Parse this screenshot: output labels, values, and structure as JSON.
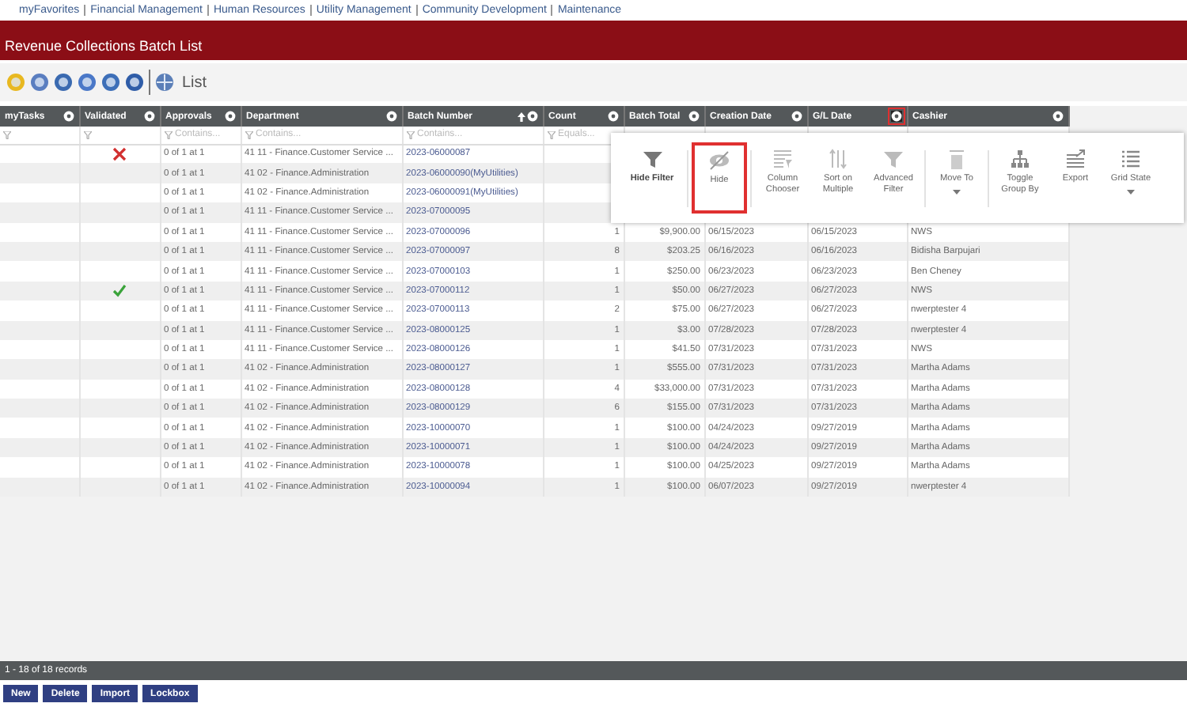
{
  "top_nav": [
    "myFavorites",
    "Financial Management",
    "Human Resources",
    "Utility Management",
    "Community Development",
    "Maintenance"
  ],
  "page_title": "Revenue Collections Batch List",
  "toolbar": {
    "label": "List"
  },
  "columns": [
    {
      "label": "myTasks",
      "filter_shown": true,
      "menu_open": false,
      "sort_ascending": false
    },
    {
      "label": "Validated",
      "filter_shown": true,
      "menu_open": false,
      "sort_ascending": false
    },
    {
      "label": "Approvals",
      "filter_shown": true,
      "filter_placeholder": "Contains...",
      "menu_open": false,
      "sort_ascending": false
    },
    {
      "label": "Department",
      "filter_shown": true,
      "filter_placeholder": "Contains...",
      "menu_open": false,
      "sort_ascending": false
    },
    {
      "label": "Batch Number",
      "filter_shown": true,
      "filter_placeholder": "Contains...",
      "menu_open": false,
      "sort_ascending": true
    },
    {
      "label": "Count",
      "filter_shown": true,
      "filter_placeholder": "Equals...",
      "menu_open": false,
      "sort_ascending": false
    },
    {
      "label": "Batch Total",
      "filter_shown": false,
      "menu_open": false,
      "sort_ascending": false
    },
    {
      "label": "Creation Date",
      "filter_shown": false,
      "menu_open": false,
      "sort_ascending": false
    },
    {
      "label": "G/L Date",
      "filter_shown": false,
      "menu_open": true,
      "sort_ascending": false
    },
    {
      "label": "Cashier",
      "filter_shown": false,
      "menu_open": false,
      "sort_ascending": false
    }
  ],
  "rows": [
    {
      "validated": false,
      "approvals": "0 of 1 at 1",
      "department": "41 11 - Finance.Customer Service ...",
      "batch": "2023-06000087"
    },
    {
      "approvals": "0 of 1 at 1",
      "department": "41 02 - Finance.Administration",
      "batch": "2023-06000090(MyUtilities)"
    },
    {
      "approvals": "0 of 1 at 1",
      "department": "41 02 - Finance.Administration",
      "batch": "2023-06000091(MyUtilities)"
    },
    {
      "approvals": "0 of 1 at 1",
      "department": "41 11 - Finance.Customer Service ...",
      "batch": "2023-07000095"
    },
    {
      "approvals": "0 of 1 at 1",
      "department": "41 11 - Finance.Customer Service ...",
      "batch": "2023-07000096",
      "count": "1",
      "total": "$9,900.00",
      "created": "06/15/2023",
      "gl": "06/15/2023",
      "cashier": "NWS"
    },
    {
      "approvals": "0 of 1 at 1",
      "department": "41 11 - Finance.Customer Service ...",
      "batch": "2023-07000097",
      "count": "8",
      "total": "$203.25",
      "created": "06/16/2023",
      "gl": "06/16/2023",
      "cashier": "Bidisha Barpujari"
    },
    {
      "approvals": "0 of 1 at 1",
      "department": "41 11 - Finance.Customer Service ...",
      "batch": "2023-07000103",
      "count": "1",
      "total": "$250.00",
      "created": "06/23/2023",
      "gl": "06/23/2023",
      "cashier": "Ben Cheney"
    },
    {
      "validated": true,
      "approvals": "0 of 1 at 1",
      "department": "41 11 - Finance.Customer Service ...",
      "batch": "2023-07000112",
      "count": "1",
      "total": "$50.00",
      "created": "06/27/2023",
      "gl": "06/27/2023",
      "cashier": "NWS"
    },
    {
      "approvals": "0 of 1 at 1",
      "department": "41 11 - Finance.Customer Service ...",
      "batch": "2023-07000113",
      "count": "2",
      "total": "$75.00",
      "created": "06/27/2023",
      "gl": "06/27/2023",
      "cashier": "nwerptester 4"
    },
    {
      "approvals": "0 of 1 at 1",
      "department": "41 11 - Finance.Customer Service ...",
      "batch": "2023-08000125",
      "count": "1",
      "total": "$3.00",
      "created": "07/28/2023",
      "gl": "07/28/2023",
      "cashier": "nwerptester 4"
    },
    {
      "approvals": "0 of 1 at 1",
      "department": "41 11 - Finance.Customer Service ...",
      "batch": "2023-08000126",
      "count": "1",
      "total": "$41.50",
      "created": "07/31/2023",
      "gl": "07/31/2023",
      "cashier": "NWS"
    },
    {
      "approvals": "0 of 1 at 1",
      "department": "41 02 - Finance.Administration",
      "batch": "2023-08000127",
      "count": "1",
      "total": "$555.00",
      "created": "07/31/2023",
      "gl": "07/31/2023",
      "cashier": "Martha Adams"
    },
    {
      "approvals": "0 of 1 at 1",
      "department": "41 02 - Finance.Administration",
      "batch": "2023-08000128",
      "count": "4",
      "total": "$33,000.00",
      "created": "07/31/2023",
      "gl": "07/31/2023",
      "cashier": "Martha Adams"
    },
    {
      "approvals": "0 of 1 at 1",
      "department": "41 02 - Finance.Administration",
      "batch": "2023-08000129",
      "count": "6",
      "total": "$155.00",
      "created": "07/31/2023",
      "gl": "07/31/2023",
      "cashier": "Martha Adams"
    },
    {
      "approvals": "0 of 1 at 1",
      "department": "41 02 - Finance.Administration",
      "batch": "2023-10000070",
      "count": "1",
      "total": "$100.00",
      "created": "04/24/2023",
      "gl": "09/27/2019",
      "cashier": "Martha Adams"
    },
    {
      "approvals": "0 of 1 at 1",
      "department": "41 02 - Finance.Administration",
      "batch": "2023-10000071",
      "count": "1",
      "total": "$100.00",
      "created": "04/24/2023",
      "gl": "09/27/2019",
      "cashier": "Martha Adams"
    },
    {
      "approvals": "0 of 1 at 1",
      "department": "41 02 - Finance.Administration",
      "batch": "2023-10000078",
      "count": "1",
      "total": "$100.00",
      "created": "04/25/2023",
      "gl": "09/27/2019",
      "cashier": "Martha Adams"
    },
    {
      "approvals": "0 of 1 at 1",
      "department": "41 02 - Finance.Administration",
      "batch": "2023-10000094",
      "count": "1",
      "total": "$100.00",
      "created": "06/07/2023",
      "gl": "09/27/2019",
      "cashier": "nwerptester 4"
    }
  ],
  "column_menu": [
    {
      "items": [
        {
          "kind": "filter",
          "label": "Hide Filter",
          "bold": true,
          "selected": false,
          "dropdown": false
        }
      ]
    },
    {
      "items": [
        {
          "kind": "hide",
          "label": "Hide",
          "bold": false,
          "selected": true,
          "dropdown": false
        }
      ]
    },
    {
      "items": [
        {
          "kind": "chooser",
          "label": "Column Chooser",
          "bold": false,
          "selected": false,
          "dropdown": false
        },
        {
          "kind": "sort",
          "label": "Sort on Multiple",
          "bold": false,
          "selected": false,
          "dropdown": false
        },
        {
          "kind": "filter",
          "label": "Advanced Filter",
          "bold": false,
          "selected": false,
          "dropdown": false
        }
      ]
    },
    {
      "items": [
        {
          "kind": "move",
          "label": "Move To",
          "bold": false,
          "selected": false,
          "dropdown": true
        }
      ]
    },
    {
      "items": [
        {
          "kind": "group",
          "label": "Toggle Group By",
          "bold": false,
          "selected": false,
          "dropdown": false
        },
        {
          "kind": "export",
          "label": "Export",
          "bold": false,
          "selected": false,
          "dropdown": false
        },
        {
          "kind": "list",
          "label": "Grid State",
          "bold": false,
          "selected": false,
          "dropdown": true
        }
      ]
    }
  ],
  "status_bar": "1 - 18 of 18 records",
  "buttons": [
    "New",
    "Delete",
    "Import",
    "Lockbox"
  ]
}
